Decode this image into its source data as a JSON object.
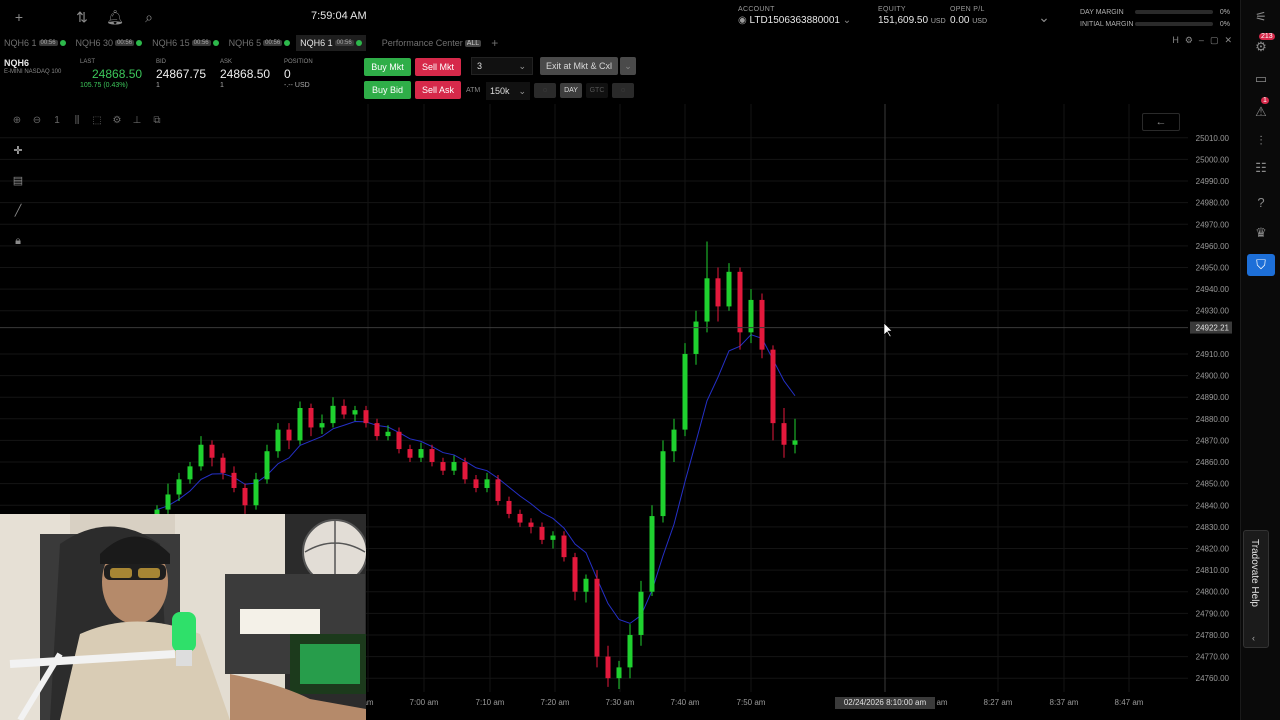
{
  "header": {
    "time": "7:59:04 AM",
    "account": {
      "label": "ACCOUNT",
      "value": "LTD1506363880001"
    },
    "equity": {
      "label": "EQUITY",
      "value": "151,609.50",
      "currency": "USD"
    },
    "open_pl": {
      "label": "OPEN P/L",
      "value": "0.00",
      "currency": "USD"
    },
    "day_margin": {
      "label": "DAY MARGIN",
      "pct": "0%"
    },
    "initial_margin": {
      "label": "INITIAL MARGIN",
      "pct": "0%"
    }
  },
  "tabs": [
    {
      "label": "NQH6 1",
      "sub": "00:56"
    },
    {
      "label": "NQH6 30",
      "sub": "00:56"
    },
    {
      "label": "NQH6 15",
      "sub": "00:56"
    },
    {
      "label": "NQH6 5",
      "sub": "00:56"
    },
    {
      "label": "NQH6 1",
      "sub": "00:56",
      "active": true
    },
    {
      "label": "Performance Center",
      "sub": "ALL"
    }
  ],
  "quote": {
    "symbol": "NQH6",
    "description": "E-MINI NASDAQ 100",
    "last_label": "LAST",
    "last": "24868.50",
    "change": "105.75 (0.43%)",
    "bid_label": "BID",
    "bid": "24867.75",
    "bid_size": "1",
    "ask_label": "ASK",
    "ask": "24868.50",
    "ask_size": "1",
    "position_label": "POSITION",
    "position": "0",
    "position_sub": "-.-- USD"
  },
  "order": {
    "buy_mkt": "Buy Mkt",
    "sell_mkt": "Sell Mkt",
    "buy_bid": "Buy Bid",
    "sell_ask": "Sell Ask",
    "quantity": "3",
    "exit": "Exit at Mkt & Cxl",
    "atm_label": "ATM",
    "atm_value": "150k",
    "tif_day": "DAY",
    "tif_gtc": "GTC"
  },
  "chart_data": {
    "type": "candlestick",
    "y_ticks": [
      "25010.00",
      "25000.00",
      "24990.00",
      "24980.00",
      "24970.00",
      "24960.00",
      "24950.00",
      "24940.00",
      "24930.00",
      "24910.00",
      "24900.00",
      "24890.00",
      "24880.00",
      "24870.00",
      "24860.00",
      "24850.00",
      "24840.00",
      "24830.00",
      "24820.00",
      "24810.00",
      "24800.00",
      "24790.00",
      "24780.00",
      "24770.00",
      "24760.00"
    ],
    "x_ticks": [
      "am",
      "7:00 am",
      "7:10 am",
      "7:20 am",
      "7:30 am",
      "7:40 am",
      "7:50 am",
      "8:27 am",
      "8:37 am",
      "8:47 am"
    ],
    "crosshair_price": "24922.21",
    "crosshair_time": "02/24/2026 8:10:00 am",
    "crosshair_time_suffix": "am",
    "ylim": [
      24755,
      25015
    ],
    "candles": [
      {
        "o": 24832,
        "c": 24838,
        "h": 24840,
        "l": 24830
      },
      {
        "o": 24838,
        "c": 24845,
        "h": 24850,
        "l": 24836
      },
      {
        "o": 24845,
        "c": 24852,
        "h": 24855,
        "l": 24842
      },
      {
        "o": 24852,
        "c": 24858,
        "h": 24860,
        "l": 24850
      },
      {
        "o": 24858,
        "c": 24868,
        "h": 24872,
        "l": 24856
      },
      {
        "o": 24868,
        "c": 24862,
        "h": 24870,
        "l": 24858
      },
      {
        "o": 24862,
        "c": 24855,
        "h": 24864,
        "l": 24852
      },
      {
        "o": 24855,
        "c": 24848,
        "h": 24858,
        "l": 24846
      },
      {
        "o": 24848,
        "c": 24840,
        "h": 24850,
        "l": 24836
      },
      {
        "o": 24840,
        "c": 24852,
        "h": 24855,
        "l": 24838
      },
      {
        "o": 24852,
        "c": 24865,
        "h": 24868,
        "l": 24850
      },
      {
        "o": 24865,
        "c": 24875,
        "h": 24878,
        "l": 24862
      },
      {
        "o": 24875,
        "c": 24870,
        "h": 24878,
        "l": 24866
      },
      {
        "o": 24870,
        "c": 24885,
        "h": 24888,
        "l": 24868
      },
      {
        "o": 24885,
        "c": 24876,
        "h": 24887,
        "l": 24872
      },
      {
        "o": 24876,
        "c": 24878,
        "h": 24882,
        "l": 24873
      },
      {
        "o": 24878,
        "c": 24886,
        "h": 24890,
        "l": 24876
      },
      {
        "o": 24886,
        "c": 24882,
        "h": 24889,
        "l": 24880
      },
      {
        "o": 24882,
        "c": 24884,
        "h": 24886,
        "l": 24879
      },
      {
        "o": 24884,
        "c": 24878,
        "h": 24886,
        "l": 24876
      },
      {
        "o": 24878,
        "c": 24872,
        "h": 24880,
        "l": 24870
      },
      {
        "o": 24872,
        "c": 24874,
        "h": 24877,
        "l": 24870
      },
      {
        "o": 24874,
        "c": 24866,
        "h": 24876,
        "l": 24864
      },
      {
        "o": 24866,
        "c": 24862,
        "h": 24868,
        "l": 24860
      },
      {
        "o": 24862,
        "c": 24866,
        "h": 24869,
        "l": 24860
      },
      {
        "o": 24866,
        "c": 24860,
        "h": 24868,
        "l": 24858
      },
      {
        "o": 24860,
        "c": 24856,
        "h": 24862,
        "l": 24854
      },
      {
        "o": 24856,
        "c": 24860,
        "h": 24863,
        "l": 24854
      },
      {
        "o": 24860,
        "c": 24852,
        "h": 24862,
        "l": 24850
      },
      {
        "o": 24852,
        "c": 24848,
        "h": 24854,
        "l": 24846
      },
      {
        "o": 24848,
        "c": 24852,
        "h": 24855,
        "l": 24846
      },
      {
        "o": 24852,
        "c": 24842,
        "h": 24854,
        "l": 24840
      },
      {
        "o": 24842,
        "c": 24836,
        "h": 24844,
        "l": 24834
      },
      {
        "o": 24836,
        "c": 24832,
        "h": 24838,
        "l": 24830
      },
      {
        "o": 24832,
        "c": 24830,
        "h": 24834,
        "l": 24827
      },
      {
        "o": 24830,
        "c": 24824,
        "h": 24832,
        "l": 24822
      },
      {
        "o": 24824,
        "c": 24826,
        "h": 24828,
        "l": 24820
      },
      {
        "o": 24826,
        "c": 24816,
        "h": 24828,
        "l": 24814
      },
      {
        "o": 24816,
        "c": 24800,
        "h": 24818,
        "l": 24796
      },
      {
        "o": 24800,
        "c": 24806,
        "h": 24808,
        "l": 24795
      },
      {
        "o": 24806,
        "c": 24770,
        "h": 24810,
        "l": 24765
      },
      {
        "o": 24770,
        "c": 24760,
        "h": 24775,
        "l": 24756
      },
      {
        "o": 24760,
        "c": 24765,
        "h": 24768,
        "l": 24755
      },
      {
        "o": 24765,
        "c": 24780,
        "h": 24785,
        "l": 24760
      },
      {
        "o": 24780,
        "c": 24800,
        "h": 24805,
        "l": 24775
      },
      {
        "o": 24800,
        "c": 24835,
        "h": 24840,
        "l": 24798
      },
      {
        "o": 24835,
        "c": 24865,
        "h": 24870,
        "l": 24832
      },
      {
        "o": 24865,
        "c": 24875,
        "h": 24880,
        "l": 24860
      },
      {
        "o": 24875,
        "c": 24910,
        "h": 24915,
        "l": 24872
      },
      {
        "o": 24910,
        "c": 24925,
        "h": 24930,
        "l": 24905
      },
      {
        "o": 24925,
        "c": 24945,
        "h": 24962,
        "l": 24920
      },
      {
        "o": 24945,
        "c": 24932,
        "h": 24950,
        "l": 24925
      },
      {
        "o": 24932,
        "c": 24948,
        "h": 24952,
        "l": 24930
      },
      {
        "o": 24948,
        "c": 24920,
        "h": 24950,
        "l": 24912
      },
      {
        "o": 24920,
        "c": 24935,
        "h": 24940,
        "l": 24915
      },
      {
        "o": 24935,
        "c": 24912,
        "h": 24938,
        "l": 24908
      },
      {
        "o": 24912,
        "c": 24878,
        "h": 24914,
        "l": 24870
      },
      {
        "o": 24878,
        "c": 24868,
        "h": 24885,
        "l": 24862
      },
      {
        "o": 24868,
        "c": 24870,
        "h": 24880,
        "l": 24864
      }
    ]
  },
  "sidebar": {
    "badge_alerts": "213",
    "badge_warn": "1",
    "help": "Tradovate Help"
  }
}
